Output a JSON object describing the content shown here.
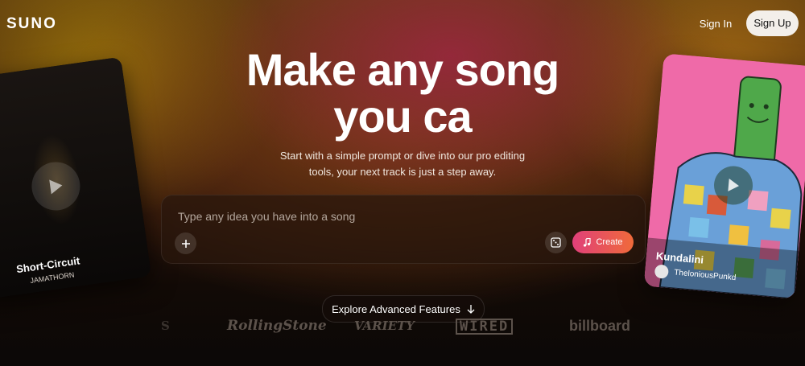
{
  "header": {
    "logo": "SUNO",
    "sign_in": "Sign In",
    "sign_up": "Sign Up"
  },
  "hero": {
    "title_line1": "Make any song",
    "title_line2": "you ca",
    "subtitle_line1": "Start with a simple prompt or dive into our pro editing",
    "subtitle_line2": "tools, your next track is just a step away."
  },
  "prompt": {
    "placeholder": "Type any idea you have into a song",
    "value": "",
    "create_label": "Create"
  },
  "cards": {
    "left": {
      "title": "Short-Circuit",
      "artist": "JAMATHORN"
    },
    "right": {
      "title": "Kundalini",
      "artist": "TheloniousPunkd"
    }
  },
  "explore": {
    "label": "Explore Advanced Features"
  },
  "press_logos": {
    "partial": "S",
    "rolling_stone": "RollingStone",
    "variety": "VARIETY",
    "wired": "WIRED",
    "billboard": "billboard"
  },
  "colors": {
    "create_gradient_start": "#e0407a",
    "create_gradient_end": "#f06a3a",
    "signup_bg": "#f3efea"
  }
}
